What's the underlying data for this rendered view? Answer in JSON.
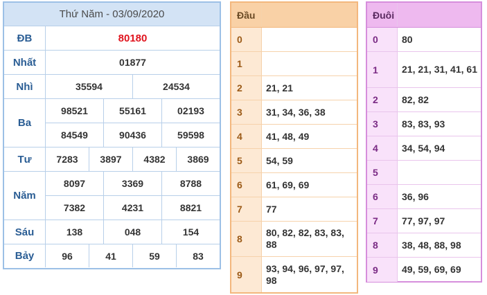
{
  "result": {
    "title": "Thứ Năm - 03/09/2020",
    "prizes": [
      {
        "name": "ĐB",
        "lines": [
          [
            "80180"
          ]
        ]
      },
      {
        "name": "Nhất",
        "lines": [
          [
            "01877"
          ]
        ]
      },
      {
        "name": "Nhì",
        "lines": [
          [
            "35594",
            "24534"
          ]
        ]
      },
      {
        "name": "Ba",
        "lines": [
          [
            "98521",
            "55161",
            "02193"
          ],
          [
            "84549",
            "90436",
            "59598"
          ]
        ]
      },
      {
        "name": "Tư",
        "lines": [
          [
            "7283",
            "3897",
            "4382",
            "3869"
          ]
        ]
      },
      {
        "name": "Năm",
        "lines": [
          [
            "8097",
            "3369",
            "8788"
          ],
          [
            "7382",
            "4231",
            "8821"
          ]
        ]
      },
      {
        "name": "Sáu",
        "lines": [
          [
            "138",
            "048",
            "154"
          ]
        ]
      },
      {
        "name": "Bảy",
        "lines": [
          [
            "96",
            "41",
            "59",
            "83"
          ]
        ]
      }
    ]
  },
  "dau": {
    "header": "Đầu",
    "rows": [
      {
        "key": "0",
        "values": ""
      },
      {
        "key": "1",
        "values": ""
      },
      {
        "key": "2",
        "values": "21, 21"
      },
      {
        "key": "3",
        "values": "31, 34, 36, 38"
      },
      {
        "key": "4",
        "values": "41, 48, 49"
      },
      {
        "key": "5",
        "values": "54, 59"
      },
      {
        "key": "6",
        "values": "61, 69, 69"
      },
      {
        "key": "7",
        "values": "77"
      },
      {
        "key": "8",
        "values": "80, 82, 82, 83, 83, 88"
      },
      {
        "key": "9",
        "values": "93, 94, 96, 97, 97, 98"
      }
    ]
  },
  "duoi": {
    "header": "Đuôi",
    "rows": [
      {
        "key": "0",
        "values": "80"
      },
      {
        "key": "1",
        "values": "21, 21, 31, 41, 61"
      },
      {
        "key": "2",
        "values": "82, 82"
      },
      {
        "key": "3",
        "values": "83, 83, 93"
      },
      {
        "key": "4",
        "values": "34, 54, 94"
      },
      {
        "key": "5",
        "values": ""
      },
      {
        "key": "6",
        "values": "36, 96"
      },
      {
        "key": "7",
        "values": "77, 97, 97"
      },
      {
        "key": "8",
        "values": "38, 48, 88, 98"
      },
      {
        "key": "9",
        "values": "49, 59, 69, 69"
      }
    ]
  },
  "colors": {
    "special_prize": "#e0141e",
    "result_header": "#d3e3f5",
    "dau_header": "#f9d1a6",
    "duoi_header": "#eeb9ef"
  }
}
